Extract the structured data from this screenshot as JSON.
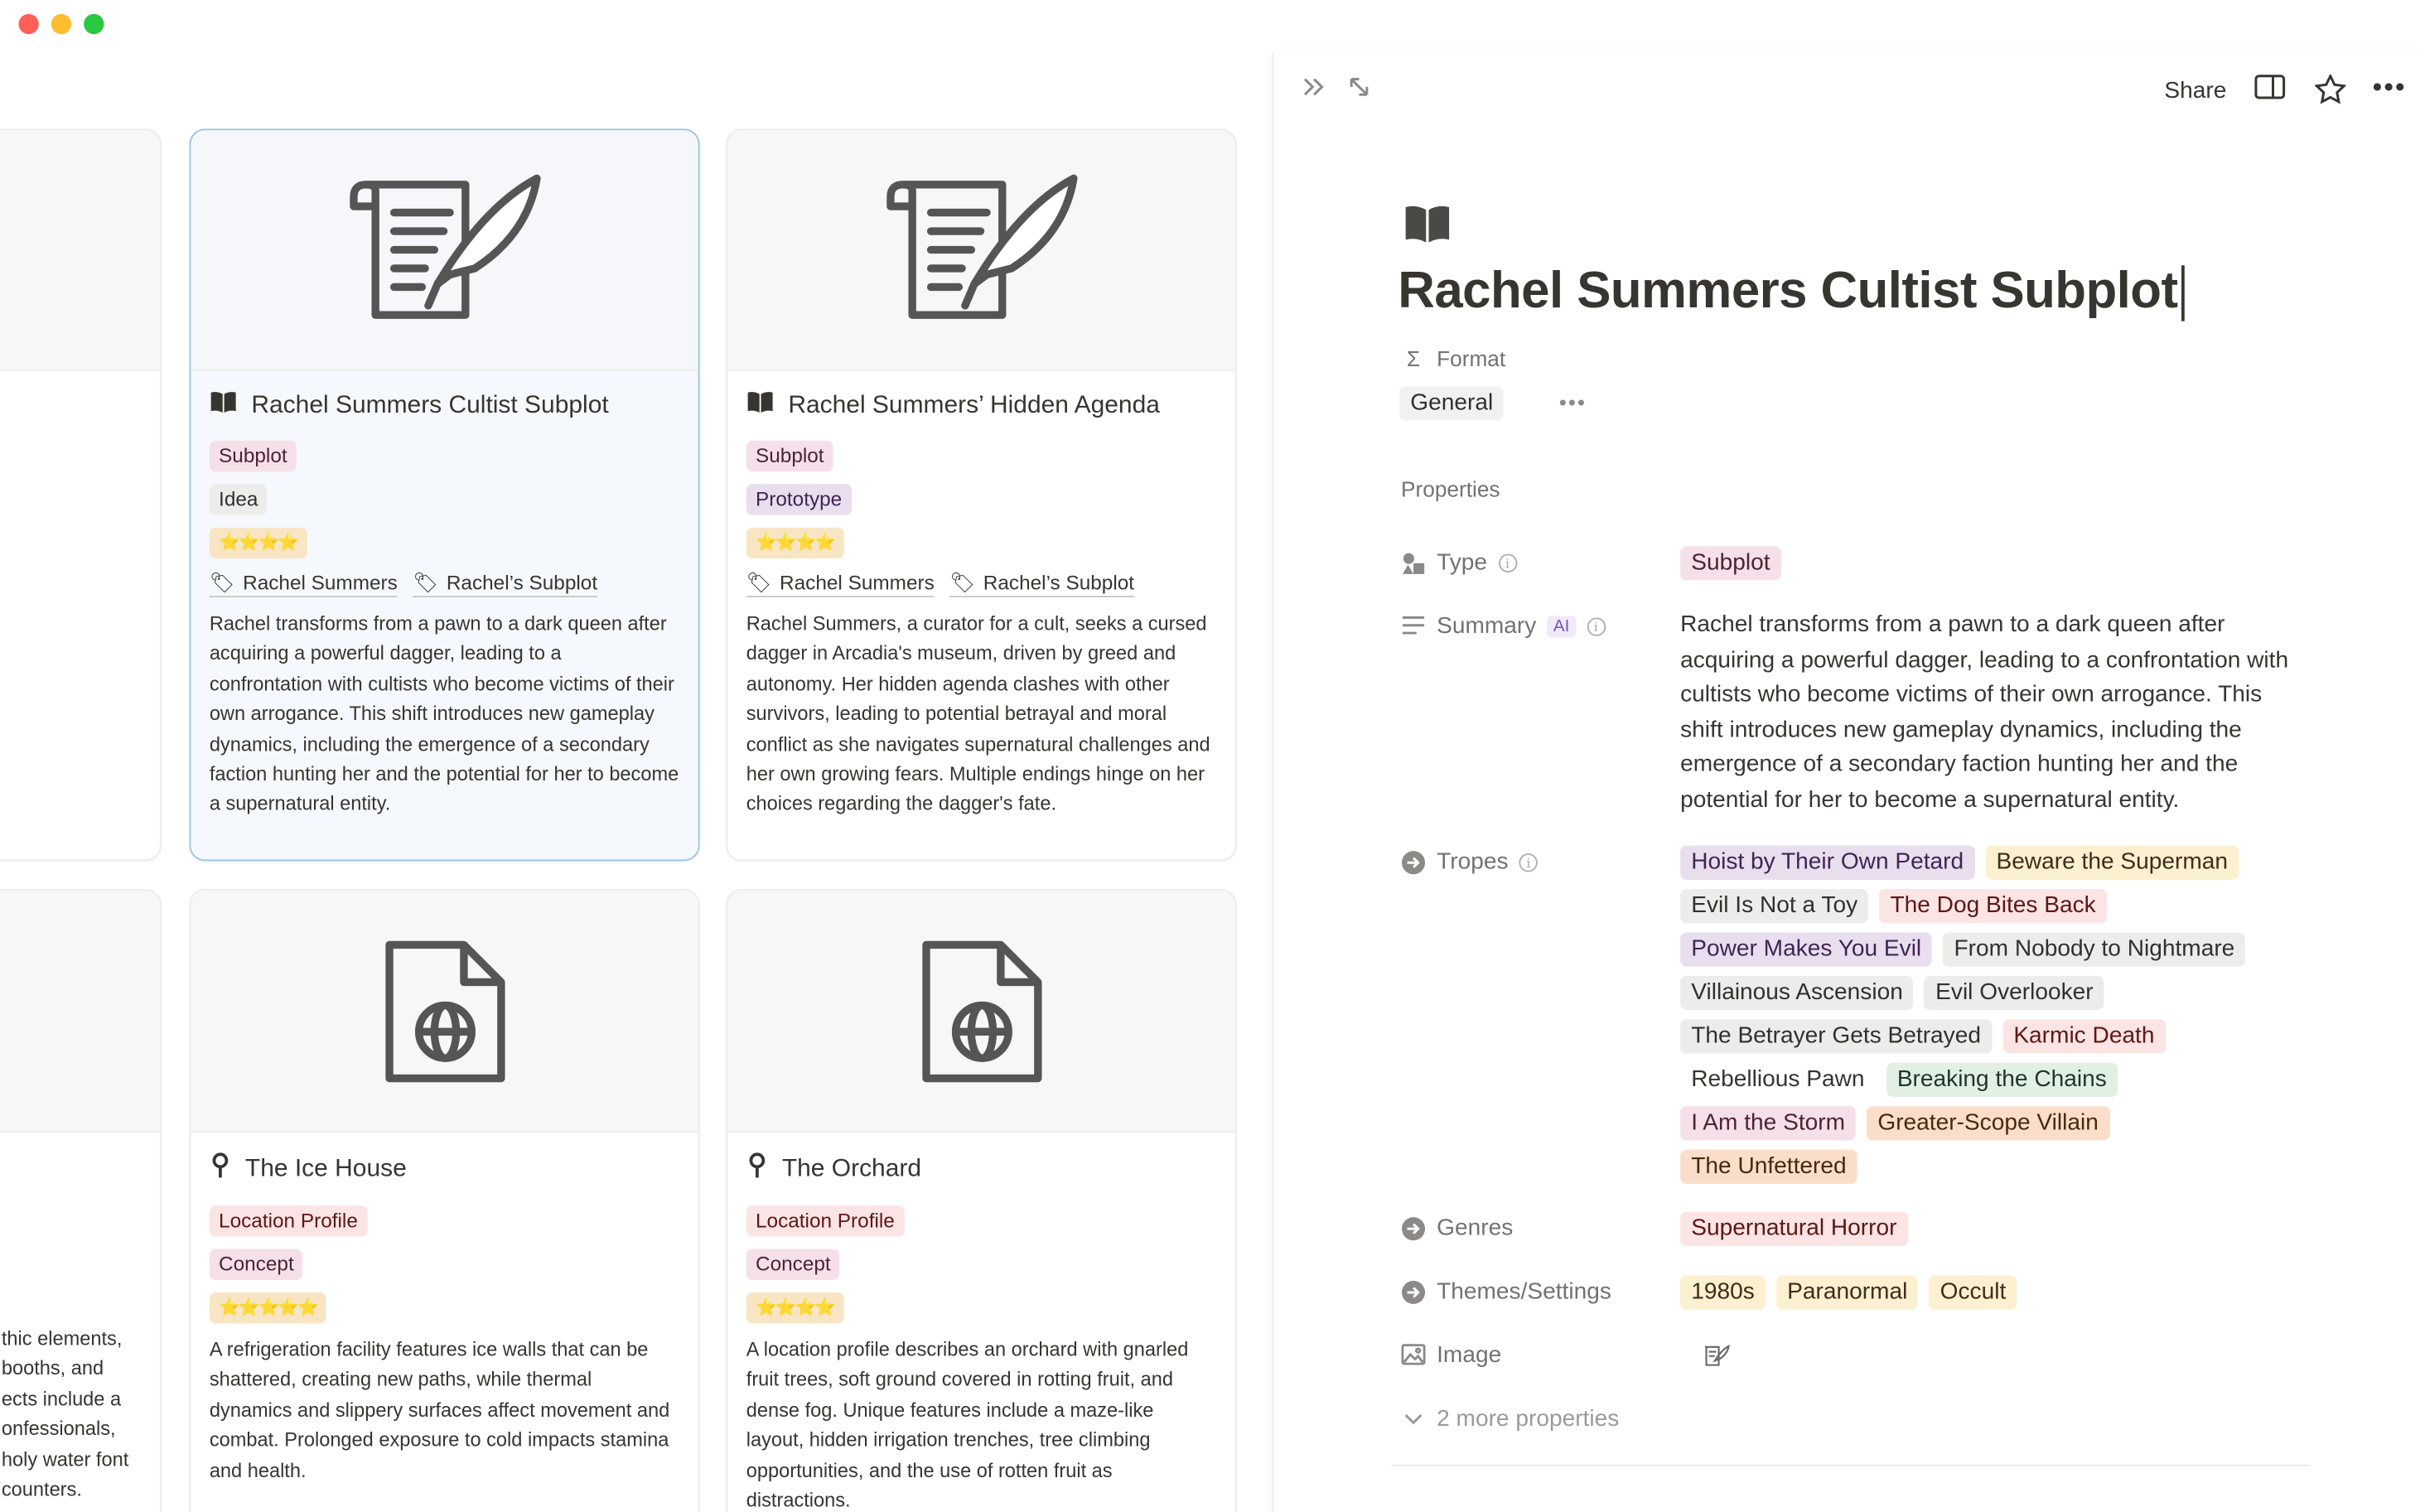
{
  "window": {
    "controls": [
      "close",
      "minimize",
      "zoom"
    ]
  },
  "gallery": {
    "cards": [
      {
        "title": "Rachel Summers Cultist Subplot",
        "icon": "book-open-icon",
        "cover_icon": "scroll-quill-icon",
        "tags": [
          {
            "label": "Subplot",
            "color": "pink"
          },
          {
            "label": "Idea",
            "color": "gray"
          }
        ],
        "rating": "⭐⭐⭐⭐",
        "relations": [
          "Rachel Summers",
          "Rachel’s Subplot"
        ],
        "description": "Rachel transforms from a pawn to a dark queen after acquiring a powerful dagger, leading to a confrontation with cultists who become victims of their own arrogance. This shift introduces new gameplay dynamics, including the emergence of a secondary faction hunting her and the potential for her to become a supernatural entity."
      },
      {
        "title": "Rachel Summers’ Hidden Agenda",
        "icon": "book-open-icon",
        "cover_icon": "scroll-quill-icon",
        "tags": [
          {
            "label": "Subplot",
            "color": "pink"
          },
          {
            "label": "Prototype",
            "color": "purple"
          }
        ],
        "rating": "⭐⭐⭐⭐",
        "relations": [
          "Rachel Summers",
          "Rachel’s Subplot"
        ],
        "description": "Rachel Summers, a curator for a cult, seeks a cursed dagger in Arcadia's museum, driven by greed and autonomy. Her hidden agenda clashes with other survivors, leading to potential betrayal and moral conflict as she navigates supernatural challenges and her own growing fears. Multiple endings hinge on her choices regarding the dagger's fate."
      },
      {
        "title": "The Ice House",
        "icon": "map-pin-icon",
        "cover_icon": "web-document-icon",
        "tags": [
          {
            "label": "Location Profile",
            "color": "red"
          },
          {
            "label": "Concept",
            "color": "pink"
          }
        ],
        "rating": "⭐⭐⭐⭐⭐",
        "relations": [],
        "description": "A refrigeration facility features ice walls that can be shattered, creating new paths, while thermal dynamics and slippery surfaces affect movement and combat. Prolonged exposure to cold impacts stamina and health."
      },
      {
        "title": "The Orchard",
        "icon": "map-pin-icon",
        "cover_icon": "web-document-icon",
        "tags": [
          {
            "label": "Location Profile",
            "color": "red"
          },
          {
            "label": "Concept",
            "color": "pink"
          }
        ],
        "rating": "⭐⭐⭐⭐",
        "relations": [],
        "description": "A location profile describes an orchard with gnarled fruit trees, soft ground covered in rotting fruit, and dense fog. Unique features include a maze-like layout, hidden irrigation trenches, tree climbing opportunities, and the use of rotten fruit as distractions."
      }
    ],
    "partial_card_text": [
      "thic elements,",
      "booths, and",
      "ects include a",
      "onfessionals,",
      "holy water font",
      "counters."
    ]
  },
  "panel": {
    "share_label": "Share",
    "page_icon": "book-open-icon",
    "title": "Rachel Summers Cultist Subplot",
    "format_label": "Format",
    "format_value": "General",
    "properties_label": "Properties",
    "type_label": "Type",
    "type_value": "Subplot",
    "summary_label": "Summary",
    "summary_badge": "AI",
    "summary_value": "Rachel transforms from a pawn to a dark queen after acquiring a powerful dagger, leading to a confrontation with cultists who become victims of their own arrogance. This shift introduces new gameplay dynamics, including the emergence of a secondary faction hunting her and the potential for her to become a supernatural entity.",
    "tropes_label": "Tropes",
    "tropes": [
      {
        "label": "Hoist by Their Own Petard",
        "color": "purple"
      },
      {
        "label": "Beware the Superman",
        "color": "yellow"
      },
      {
        "label": "Evil Is Not a Toy",
        "color": "gray"
      },
      {
        "label": "The Dog Bites Back",
        "color": "red"
      },
      {
        "label": "Power Makes You Evil",
        "color": "purple"
      },
      {
        "label": "From Nobody to Nightmare",
        "color": "gray"
      },
      {
        "label": "Villainous Ascension",
        "color": "gray"
      },
      {
        "label": "Evil Overlooker",
        "color": "gray"
      },
      {
        "label": "The Betrayer Gets Betrayed",
        "color": "gray"
      },
      {
        "label": "Karmic Death",
        "color": "red"
      },
      {
        "label": "Rebellious Pawn",
        "color": "white"
      },
      {
        "label": "Breaking the Chains",
        "color": "green"
      },
      {
        "label": "I Am the Storm",
        "color": "pink"
      },
      {
        "label": "Greater-Scope Villain",
        "color": "peach"
      },
      {
        "label": "The Unfettered",
        "color": "peach"
      }
    ],
    "genres_label": "Genres",
    "genres": [
      {
        "label": "Supernatural Horror",
        "color": "red"
      }
    ],
    "themes_label": "Themes/Settings",
    "themes": [
      {
        "label": "1980s",
        "color": "yellow"
      },
      {
        "label": "Paranormal",
        "color": "yellow"
      },
      {
        "label": "Occult",
        "color": "yellow"
      }
    ],
    "image_label": "Image",
    "more_label": "2 more properties"
  }
}
